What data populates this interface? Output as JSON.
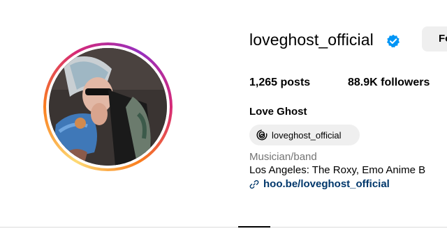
{
  "profile": {
    "username": "loveghost_official",
    "verified": true,
    "follow_label": "Fo",
    "stats": {
      "posts_count": "1,265",
      "posts_label": "posts",
      "followers_count": "88.9K",
      "followers_label": "followers"
    },
    "display_name": "Love Ghost",
    "threads_handle": "loveghost_official",
    "category": "Musician/band",
    "bio": "Los Angeles: The Roxy, Emo Anime B",
    "link": "hoo.be/loveghost_official"
  },
  "colors": {
    "verified_badge": "#0095f6",
    "link": "#00376b",
    "category": "#737373",
    "pill_bg": "#efefef"
  },
  "icons": [
    "verified-badge-icon",
    "threads-icon",
    "link-icon"
  ]
}
